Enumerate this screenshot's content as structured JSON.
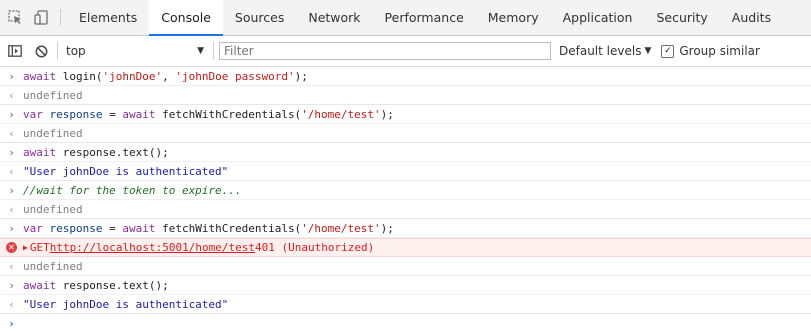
{
  "toolbar": {
    "inspect_icon": "inspect-element-icon",
    "device_icon": "device-toolbar-icon",
    "tabs": [
      {
        "label": "Elements",
        "active": false
      },
      {
        "label": "Console",
        "active": true
      },
      {
        "label": "Sources",
        "active": false
      },
      {
        "label": "Network",
        "active": false
      },
      {
        "label": "Performance",
        "active": false
      },
      {
        "label": "Memory",
        "active": false
      },
      {
        "label": "Application",
        "active": false
      },
      {
        "label": "Security",
        "active": false
      },
      {
        "label": "Audits",
        "active": false
      }
    ]
  },
  "filterbar": {
    "sidebar_icon": "show-console-sidebar-icon",
    "clear_icon": "clear-console-icon",
    "context": "top",
    "filter_placeholder": "Filter",
    "levels_label": "Default levels",
    "group_similar_label": "Group similar",
    "group_similar_checked": true
  },
  "console": {
    "entries": [
      {
        "kind": "input",
        "parts": [
          {
            "t": "await ",
            "c": "kw"
          },
          {
            "t": "login(",
            "c": "plain"
          },
          {
            "t": "'johnDoe'",
            "c": "str"
          },
          {
            "t": ", ",
            "c": "plain"
          },
          {
            "t": "'johnDoe password'",
            "c": "str"
          },
          {
            "t": ");",
            "c": "plain"
          }
        ]
      },
      {
        "kind": "result",
        "parts": [
          {
            "t": "undefined",
            "c": "undef"
          }
        ]
      },
      {
        "kind": "input",
        "parts": [
          {
            "t": "var ",
            "c": "kw"
          },
          {
            "t": "response",
            "c": "var"
          },
          {
            "t": " = ",
            "c": "plain"
          },
          {
            "t": "await ",
            "c": "kw"
          },
          {
            "t": "fetchWithCredentials(",
            "c": "plain"
          },
          {
            "t": "'/home/test'",
            "c": "str"
          },
          {
            "t": ");",
            "c": "plain"
          }
        ]
      },
      {
        "kind": "result",
        "parts": [
          {
            "t": "undefined",
            "c": "undef"
          }
        ]
      },
      {
        "kind": "input",
        "parts": [
          {
            "t": "await ",
            "c": "kw"
          },
          {
            "t": "response.text();",
            "c": "plain"
          }
        ]
      },
      {
        "kind": "result",
        "parts": [
          {
            "t": "\"User johnDoe is authenticated\"",
            "c": "outstr"
          }
        ]
      },
      {
        "kind": "input",
        "parts": [
          {
            "t": "//wait for the token to expire...",
            "c": "comment"
          }
        ]
      },
      {
        "kind": "result",
        "parts": [
          {
            "t": "undefined",
            "c": "undef"
          }
        ]
      },
      {
        "kind": "input",
        "parts": [
          {
            "t": "var ",
            "c": "kw"
          },
          {
            "t": "response",
            "c": "var"
          },
          {
            "t": " = ",
            "c": "plain"
          },
          {
            "t": "await ",
            "c": "kw"
          },
          {
            "t": "fetchWithCredentials(",
            "c": "plain"
          },
          {
            "t": "'/home/test'",
            "c": "str"
          },
          {
            "t": ");",
            "c": "plain"
          }
        ]
      },
      {
        "kind": "error",
        "method": "GET",
        "url": "http://localhost:5001/home/test",
        "status": "401 (Unauthorized)"
      },
      {
        "kind": "result",
        "parts": [
          {
            "t": "undefined",
            "c": "undef"
          }
        ]
      },
      {
        "kind": "input",
        "parts": [
          {
            "t": "await ",
            "c": "kw"
          },
          {
            "t": "response.text();",
            "c": "plain"
          }
        ]
      },
      {
        "kind": "result",
        "parts": [
          {
            "t": "\"User johnDoe is authenticated\"",
            "c": "outstr"
          }
        ]
      }
    ],
    "prompt_symbol": "›"
  },
  "colors": {
    "accent": "#1a73e8",
    "error_text": "#e01b1b",
    "error_bg": "#fff0f0"
  }
}
